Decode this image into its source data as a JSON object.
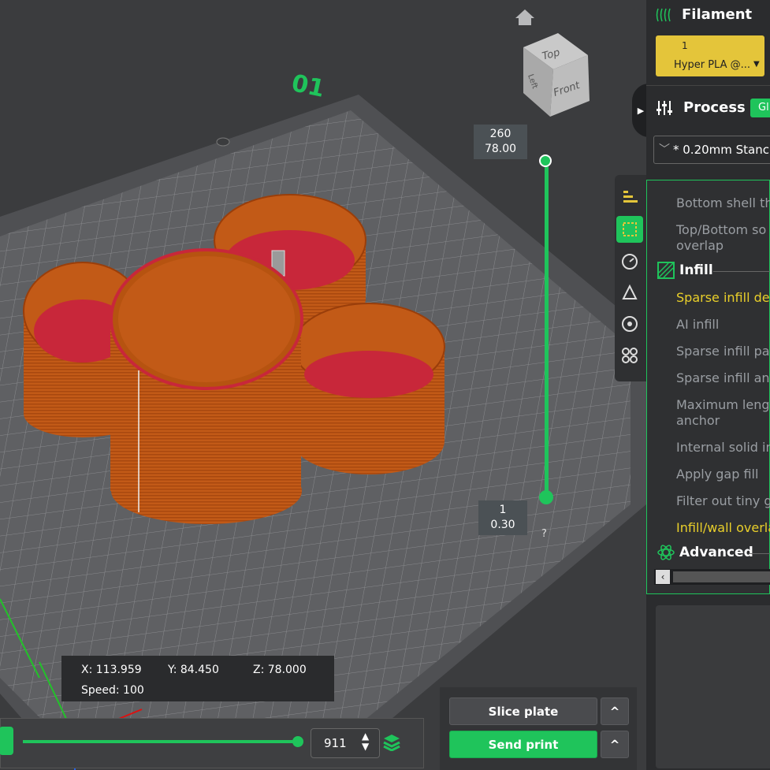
{
  "scene": {
    "plate_label": "01",
    "view_cube": {
      "top": "Top",
      "left": "Left",
      "front": "Front"
    }
  },
  "layer_slider": {
    "top": {
      "layer": "260",
      "height": "78.00"
    },
    "bottom": {
      "layer": "1",
      "height": "0.30"
    },
    "help": "?"
  },
  "coords": {
    "x": "X: 113.959",
    "y": "Y: 84.450",
    "z": "Z: 78.000",
    "speed": "Speed: 100"
  },
  "move_slider": {
    "value": "911",
    "fill_fraction": 1.0
  },
  "actions": {
    "slice": "Slice plate",
    "send": "Send print",
    "chevron": "^"
  },
  "right_panel": {
    "filament_title": "Filament",
    "filament_slot": {
      "number": "1",
      "name": "Hyper PLA @..."
    },
    "process_title": "Process",
    "process_badge": "Gl",
    "preset": "* 0.20mm Stanc",
    "params": [
      {
        "label": "Bottom shell th",
        "highlight": false
      },
      {
        "label": "Top/Bottom so",
        "label2": "overlap",
        "highlight": false
      },
      {
        "label": "Sparse infill der",
        "highlight": true
      },
      {
        "label": "AI infill",
        "highlight": false
      },
      {
        "label": "Sparse infill pat",
        "highlight": false
      },
      {
        "label": "Sparse infill anc",
        "highlight": false
      },
      {
        "label": "Maximum lengt",
        "label2": "anchor",
        "highlight": false
      },
      {
        "label": "Internal solid in",
        "highlight": false
      },
      {
        "label": "Apply gap fill",
        "highlight": false
      },
      {
        "label": "Filter out tiny g",
        "highlight": false
      },
      {
        "label": "Infill/wall overla",
        "highlight": true
      }
    ],
    "section_infill": "Infill",
    "section_advanced": "Advanced"
  },
  "colors": {
    "accent_green": "#1fc45b",
    "filament_yellow": "#e4c53a",
    "model_orange": "#c45a17",
    "highlight_text": "#e9cf2a"
  }
}
